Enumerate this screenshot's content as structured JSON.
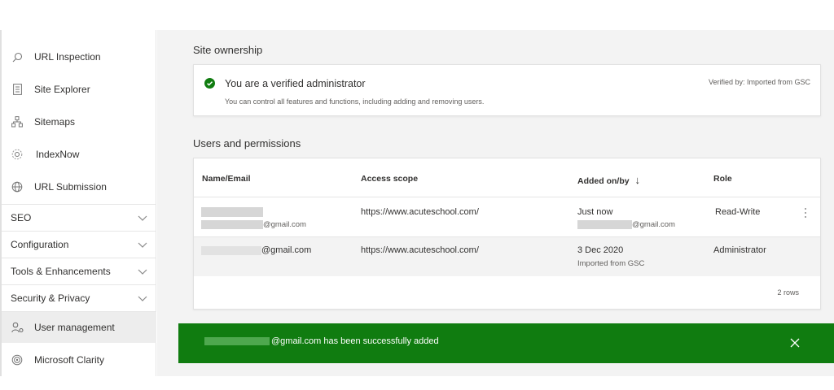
{
  "sidebar": {
    "items": [
      {
        "label": "URL Inspection",
        "icon": "search-icon"
      },
      {
        "label": "Site Explorer",
        "icon": "document-list-icon"
      },
      {
        "label": "Sitemaps",
        "icon": "sitemap-icon"
      },
      {
        "label": "IndexNow",
        "icon": "indexnow-icon"
      },
      {
        "label": "URL Submission",
        "icon": "globe-icon"
      }
    ],
    "groups": [
      {
        "label": "SEO"
      },
      {
        "label": "Configuration"
      },
      {
        "label": "Tools & Enhancements"
      },
      {
        "label": "Security & Privacy"
      }
    ],
    "bottom_items": [
      {
        "label": "User management",
        "icon": "user-settings-icon",
        "active": true
      },
      {
        "label": "Microsoft Clarity",
        "icon": "clarity-icon"
      }
    ]
  },
  "ownership": {
    "section_title": "Site ownership",
    "status_title": "You are a verified administrator",
    "status_desc": "You can control all features and functions, including adding and removing users.",
    "verified_by": "Verified by: Imported from GSC",
    "status_color": "#107c10"
  },
  "users": {
    "section_title": "Users and permissions",
    "columns": [
      "Name/Email",
      "Access scope",
      "Added on/by",
      "Role"
    ],
    "sort_indicator": "↓",
    "rows": [
      {
        "email_suffix": "@gmail.com",
        "scope": "https://www.acuteschool.com/",
        "added_on": "Just now",
        "added_by_suffix": "@gmail.com",
        "role": "Read-Write"
      },
      {
        "email_suffix": "@gmail.com",
        "scope": "https://www.acuteschool.com/",
        "added_on": "3 Dec 2020",
        "added_by": "Imported from GSC",
        "role": "Administrator"
      }
    ],
    "row_count": "2 rows"
  },
  "toast": {
    "message": "@gmail.com has been successfully added",
    "color": "#107c10"
  }
}
